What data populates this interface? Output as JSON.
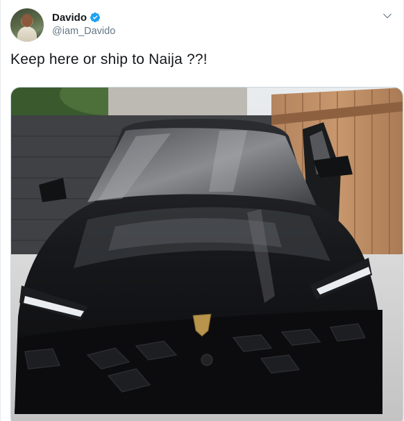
{
  "author": {
    "display_name": "Davido",
    "handle": "@iam_Davido",
    "verified": true,
    "avatar_icon": "profile-photo",
    "verified_icon": "verified-badge-icon"
  },
  "tweet": {
    "text": "Keep here or ship to Naija ??!"
  },
  "menu": {
    "icon": "chevron-down-icon"
  },
  "colors": {
    "name": "#14171a",
    "handle": "#657786",
    "verified": "#1da1f2",
    "border": "#e6ecf0"
  }
}
